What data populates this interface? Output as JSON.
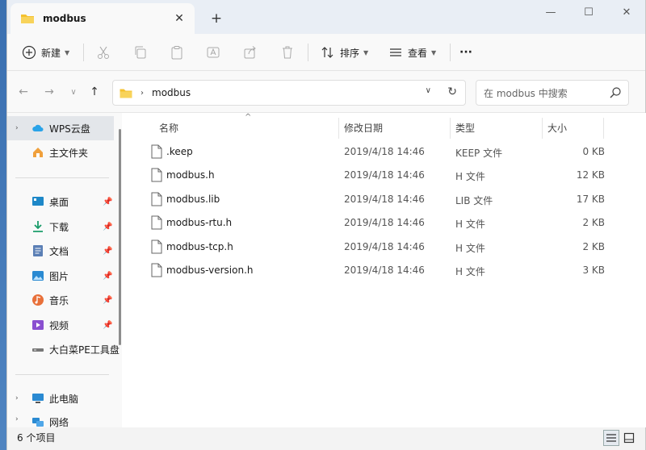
{
  "tab": {
    "title": "modbus",
    "close": "✕",
    "new": "+"
  },
  "window_controls": {
    "minimize": "—",
    "maximize": "☐",
    "close": "✕"
  },
  "toolbar": {
    "new_label": "新建",
    "sort_label": "排序",
    "view_label": "查看",
    "more": "···"
  },
  "address": {
    "crumb": "modbus",
    "search_placeholder": "在 modbus 中搜索"
  },
  "sidebar": {
    "items": [
      {
        "label": "WPS云盘",
        "icon": "cloud-icon"
      },
      {
        "label": "主文件夹",
        "icon": "home-icon"
      },
      {
        "label": "桌面",
        "icon": "desktop-icon"
      },
      {
        "label": "下载",
        "icon": "download-icon"
      },
      {
        "label": "文档",
        "icon": "document-icon"
      },
      {
        "label": "图片",
        "icon": "picture-icon"
      },
      {
        "label": "音乐",
        "icon": "music-icon"
      },
      {
        "label": "视频",
        "icon": "video-icon"
      },
      {
        "label": "大白菜PE工具盘",
        "icon": "drive-icon"
      },
      {
        "label": "此电脑",
        "icon": "computer-icon"
      },
      {
        "label": "网络",
        "icon": "network-icon"
      }
    ]
  },
  "columns": {
    "name": "名称",
    "date": "修改日期",
    "type": "类型",
    "size": "大小"
  },
  "files": [
    {
      "name": ".keep",
      "date": "2019/4/18 14:46",
      "type": "KEEP 文件",
      "size": "0 KB"
    },
    {
      "name": "modbus.h",
      "date": "2019/4/18 14:46",
      "type": "H 文件",
      "size": "12 KB"
    },
    {
      "name": "modbus.lib",
      "date": "2019/4/18 14:46",
      "type": "LIB 文件",
      "size": "17 KB"
    },
    {
      "name": "modbus-rtu.h",
      "date": "2019/4/18 14:46",
      "type": "H 文件",
      "size": "2 KB"
    },
    {
      "name": "modbus-tcp.h",
      "date": "2019/4/18 14:46",
      "type": "H 文件",
      "size": "2 KB"
    },
    {
      "name": "modbus-version.h",
      "date": "2019/4/18 14:46",
      "type": "H 文件",
      "size": "3 KB"
    }
  ],
  "status": {
    "count": "6 个项目"
  },
  "colors": {
    "folder": "#f4c12f",
    "accent": "#0067c0"
  }
}
